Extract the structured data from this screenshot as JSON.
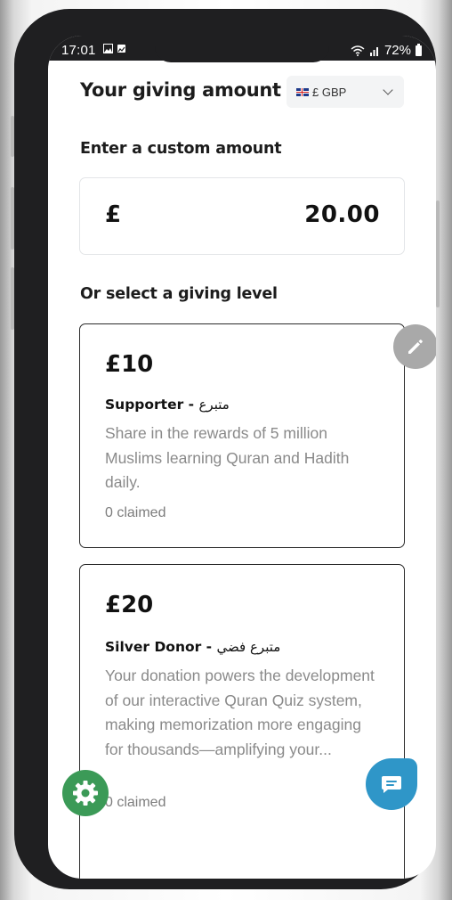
{
  "status_bar": {
    "time": "17:01",
    "battery": "72%"
  },
  "header": {
    "title": "Your giving amount",
    "currency": {
      "selected": "£ GBP"
    }
  },
  "custom_amount": {
    "label": "Enter a custom amount",
    "symbol": "£",
    "value": "20.00"
  },
  "giving_levels": {
    "label": "Or select a giving level",
    "items": [
      {
        "price": "£10",
        "name": "Supporter - ",
        "name_ar": "متبرع",
        "description": "Share in the rewards of 5 million Muslims learning Quran and Hadith daily.",
        "claimed": "0 claimed"
      },
      {
        "price": "£20",
        "name": "Silver Donor - ",
        "name_ar": "متبرع فضي",
        "description": "Your donation powers the development of our interactive Quran Quiz system, making memorization more engaging for thousands—amplifying your...",
        "claimed": "0 claimed"
      }
    ]
  },
  "icons": {
    "edit": "pencil-icon",
    "settings": "gear-icon",
    "chat": "chat-icon"
  },
  "colors": {
    "settings_fab": "#3b9a57",
    "chat_fab": "#2f96c8",
    "edit_fab": "#a9a9a9"
  }
}
